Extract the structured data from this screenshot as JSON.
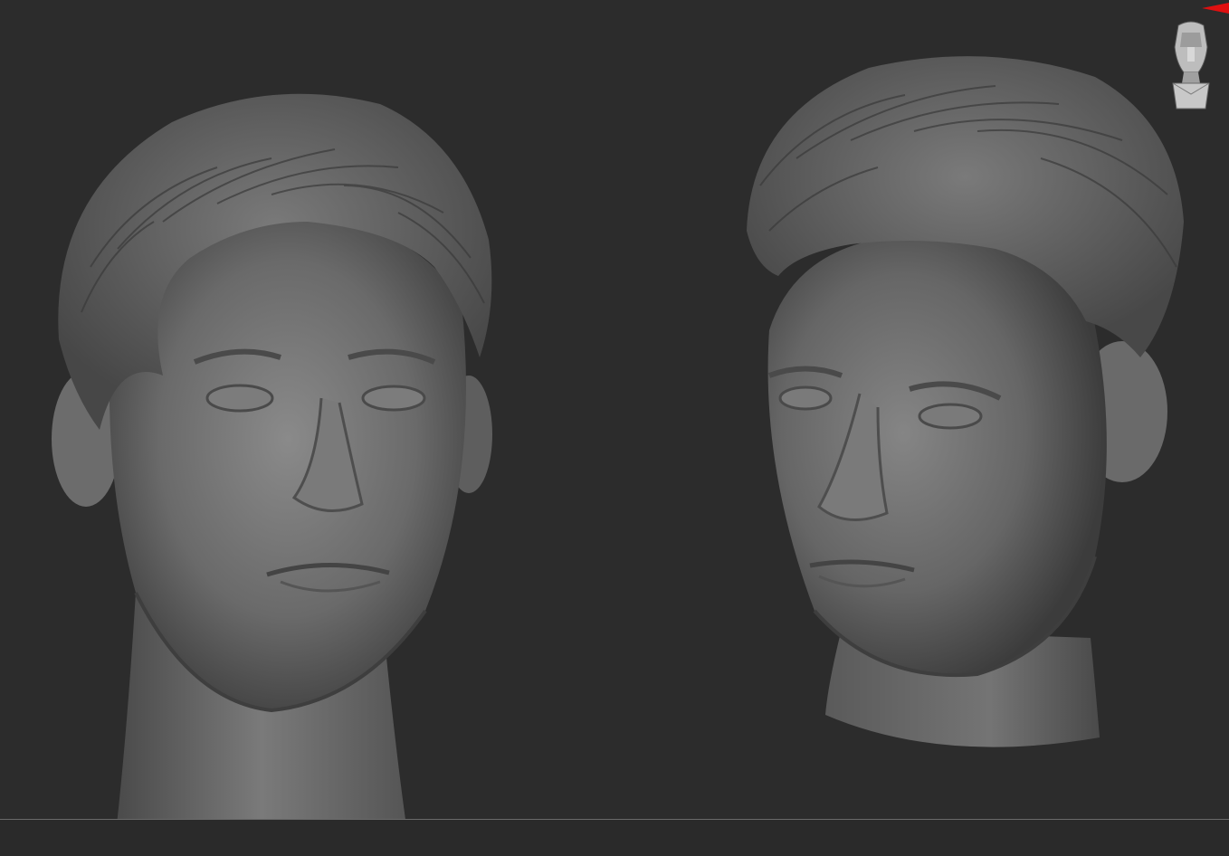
{
  "viewport": {
    "background": "#2c2c2c",
    "floor_line_color": "#6a6a6a"
  },
  "models": [
    {
      "id": "head-front",
      "view": "front",
      "material_color": "#6e6e6e"
    },
    {
      "id": "head-three-quarter",
      "view": "three-quarter",
      "material_color": "#6e6e6e"
    }
  ],
  "navigation": {
    "icon": "orientation-head-icon",
    "flag_color": "#e01010"
  }
}
